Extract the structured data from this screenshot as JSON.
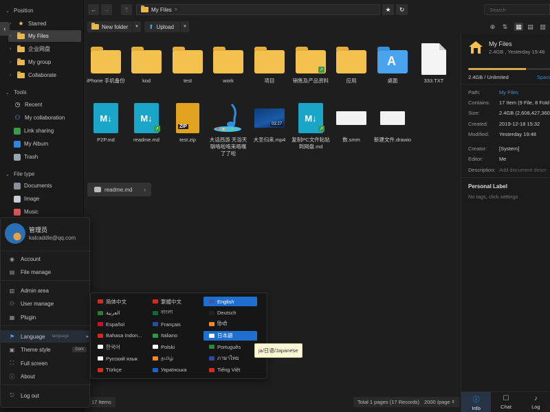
{
  "sidebar": {
    "sections": [
      {
        "title": "Position"
      },
      {
        "title": "Tools"
      },
      {
        "title": "File type"
      }
    ],
    "position_items": [
      {
        "label": "Starred",
        "icon": "star-icon"
      },
      {
        "label": "My Files",
        "icon": "home-folder-icon"
      },
      {
        "label": "企业网盘",
        "icon": "folder-icon"
      },
      {
        "label": "My group",
        "icon": "folder-icon"
      },
      {
        "label": "Collaborate",
        "icon": "folder-icon"
      }
    ],
    "tool_items": [
      {
        "label": "Recent",
        "icon": "clock-icon"
      },
      {
        "label": "My collaboration",
        "icon": "users-icon"
      },
      {
        "label": "Link sharing",
        "icon": "share-icon"
      },
      {
        "label": "My Album",
        "icon": "album-icon"
      },
      {
        "label": "Trash",
        "icon": "trash-icon"
      }
    ],
    "type_items": [
      {
        "label": "Documents",
        "icon": "document-icon"
      },
      {
        "label": "Image",
        "icon": "image-icon"
      },
      {
        "label": "Music",
        "icon": "music-icon"
      }
    ]
  },
  "user_menu": {
    "name": "管理员",
    "email": "kalcaddle@qq.com",
    "items": [
      {
        "label": "Account",
        "icon": "account-icon"
      },
      {
        "label": "File manage",
        "icon": "file-manage-icon"
      },
      {
        "label": "Admin area",
        "icon": "chart-icon"
      },
      {
        "label": "User manage",
        "icon": "user-manage-icon"
      },
      {
        "label": "Plugin",
        "icon": "plugin-icon"
      },
      {
        "label": "Language",
        "hint": "language",
        "icon": "flag-icon"
      },
      {
        "label": "Theme style",
        "badge": "Dark",
        "icon": "theme-icon"
      },
      {
        "label": "Full screen",
        "icon": "fullscreen-icon"
      },
      {
        "label": "About",
        "icon": "info-icon"
      },
      {
        "label": "Log out",
        "icon": "logout-icon"
      }
    ]
  },
  "languages": [
    {
      "label": "简体中文",
      "flag": "#d52b1e"
    },
    {
      "label": "繁體中文",
      "flag": "#d52b1e"
    },
    {
      "label": "English",
      "flag": "#3c5aa8",
      "selected": true
    },
    {
      "label": "العربية",
      "flag": "#2a7a3b"
    },
    {
      "label": "বাংলা",
      "flag": "#0a6a42"
    },
    {
      "label": "Deutsch",
      "flag": "#222"
    },
    {
      "label": "Español",
      "flag": "#c8102e"
    },
    {
      "label": "Français",
      "flag": "#2a4aa8"
    },
    {
      "label": "हिन्दी",
      "flag": "#f28c28"
    },
    {
      "label": "Bahasa Indon...",
      "flag": "#d52b1e"
    },
    {
      "label": "Italiano",
      "flag": "#2a9a45"
    },
    {
      "label": "日本語",
      "flag": "#ffffff",
      "selected": true
    },
    {
      "label": "한국어",
      "flag": "#ffffff"
    },
    {
      "label": "Polski",
      "flag": "#ffffff"
    },
    {
      "label": "Português",
      "flag": "#2a8a3b"
    },
    {
      "label": "Русский язык",
      "flag": "#ffffff"
    },
    {
      "label": "தமிழ்",
      "flag": "#f28c28"
    },
    {
      "label": "ภาษาไทย",
      "flag": "#2a4aa8"
    },
    {
      "label": "Türkçe",
      "flag": "#d52b1e"
    },
    {
      "label": "Українська",
      "flag": "#1f62c9"
    },
    {
      "label": "Tiếng Việt",
      "flag": "#d52b1e"
    }
  ],
  "tooltip": "ja/日语/Japanese",
  "toolbar": {
    "path_root": "My Files",
    "path_sep": ">",
    "search_placeholder": "Search",
    "new_folder": "New folder",
    "upload": "Upload"
  },
  "files": [
    {
      "name": "iPhone 手机备份",
      "type": "folder"
    },
    {
      "name": "kod",
      "type": "folder"
    },
    {
      "name": "test",
      "type": "folder"
    },
    {
      "name": "work",
      "type": "folder"
    },
    {
      "name": "项目",
      "type": "folder"
    },
    {
      "name": "销售及产品资料",
      "type": "folder-shared"
    },
    {
      "name": "应用",
      "type": "folder"
    },
    {
      "name": "桌面",
      "type": "folder-app"
    },
    {
      "name": "333.TXT",
      "type": "txt"
    },
    {
      "name": "P2P.md",
      "type": "md"
    },
    {
      "name": "readme.md",
      "type": "md-shared"
    },
    {
      "name": "test.zip",
      "type": "zip"
    },
    {
      "name": "大话西游 天浴天聊咯啦咯来唔嘴了了啦",
      "type": "music"
    },
    {
      "name": "大圣归来.mp4",
      "type": "video",
      "duration": "03:27"
    },
    {
      "name": "复制PC文件粘贴到网盘.md",
      "type": "md-shared"
    },
    {
      "name": "数.smm",
      "type": "thumb"
    },
    {
      "name": "新建文件.drawio",
      "type": "thumb2"
    }
  ],
  "readme_chip": "readme.md",
  "footer": {
    "items_count": "17 Items",
    "pages": "Total 1 pages (17 Records)",
    "per_page": "2000 /page"
  },
  "panel": {
    "title": "My Files",
    "subtitle": "2.4GB , Yesterday 19:48",
    "usage_fraction": 0.7,
    "usage": "2.4GB / Unlimited",
    "space_link": "Space",
    "rows": [
      {
        "k": "Path:",
        "v": "My Files",
        "style": "link"
      },
      {
        "k": "Contains:",
        "v": "17 Item (9 File, 8 Fold"
      },
      {
        "k": "Size:",
        "v": "2.4GB (2,608,427,360"
      },
      {
        "k": "Created:",
        "v": "2019-12-18 15:32"
      },
      {
        "k": "Modified:",
        "v": "Yesterday 19:48"
      },
      {
        "k": "Creator:",
        "v": "[System]"
      },
      {
        "k": "Editor:",
        "v": "Me"
      },
      {
        "k": "Description:",
        "v": "Add document descr",
        "style": "ph"
      }
    ],
    "label_title": "Personal Label",
    "tags_placeholder": "No tags, click settings",
    "tabs": [
      {
        "label": "Info",
        "icon": "info-icon",
        "active": true
      },
      {
        "label": "Chat",
        "icon": "chat-icon"
      },
      {
        "label": "Log",
        "icon": "bell-icon"
      }
    ]
  },
  "colors": {
    "accent": "#1f6fd1",
    "folder": "#f2c14e",
    "md": "#1aa6c9",
    "link": "#3c8fe0"
  }
}
